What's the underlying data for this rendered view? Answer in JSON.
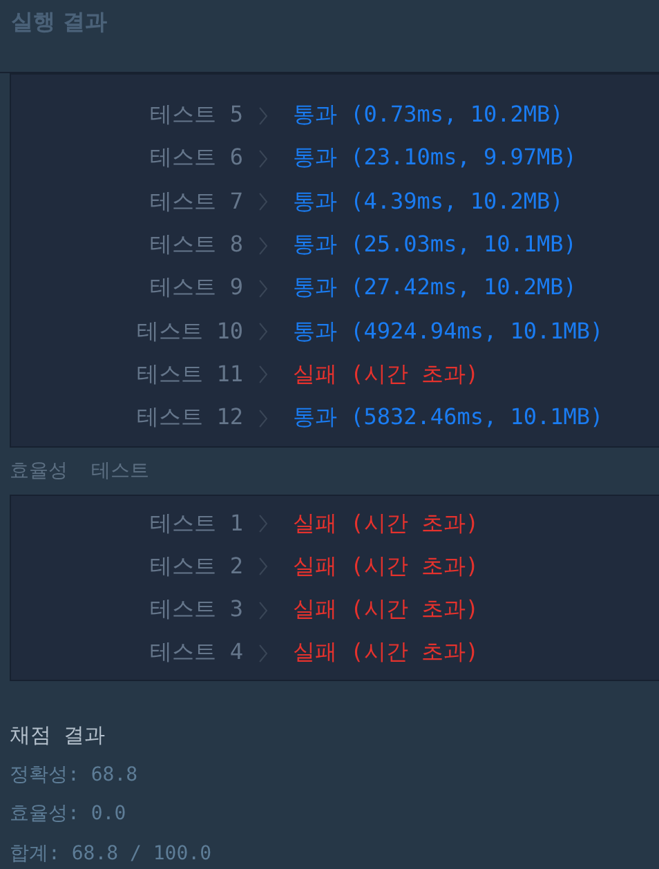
{
  "header": {
    "title": "실행 결과"
  },
  "accuracy_tests": [
    {
      "label": "테스트 5",
      "passed": true,
      "result": "통과",
      "detail": "(0.73ms, 10.2MB)"
    },
    {
      "label": "테스트 6",
      "passed": true,
      "result": "통과",
      "detail": "(23.10ms, 9.97MB)"
    },
    {
      "label": "테스트 7",
      "passed": true,
      "result": "통과",
      "detail": "(4.39ms, 10.2MB)"
    },
    {
      "label": "테스트 8",
      "passed": true,
      "result": "통과",
      "detail": "(25.03ms, 10.1MB)"
    },
    {
      "label": "테스트 9",
      "passed": true,
      "result": "통과",
      "detail": "(27.42ms, 10.2MB)"
    },
    {
      "label": "테스트 10",
      "passed": true,
      "result": "통과",
      "detail": "(4924.94ms, 10.1MB)"
    },
    {
      "label": "테스트 11",
      "passed": false,
      "result": "실패",
      "detail": "(시간 초과)"
    },
    {
      "label": "테스트 12",
      "passed": true,
      "result": "통과",
      "detail": "(5832.46ms, 10.1MB)"
    }
  ],
  "efficiency_section": {
    "title": "효율성  테스트"
  },
  "efficiency_tests": [
    {
      "label": "테스트 1",
      "passed": false,
      "result": "실패",
      "detail": "(시간 초과)"
    },
    {
      "label": "테스트 2",
      "passed": false,
      "result": "실패",
      "detail": "(시간 초과)"
    },
    {
      "label": "테스트 3",
      "passed": false,
      "result": "실패",
      "detail": "(시간 초과)"
    },
    {
      "label": "테스트 4",
      "passed": false,
      "result": "실패",
      "detail": "(시간 초과)"
    }
  ],
  "grading": {
    "title": "채점 결과",
    "lines": [
      "정확성: 68.8",
      "효율성: 0.0",
      "합계: 68.8 / 100.0"
    ]
  }
}
